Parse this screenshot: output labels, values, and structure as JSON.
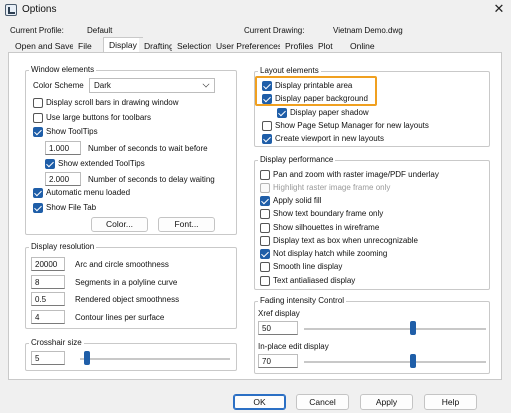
{
  "window": {
    "title": "Options",
    "close_glyph": "✕"
  },
  "header": {
    "current_profile_label": "Current Profile:",
    "current_profile_value": "Default",
    "current_drawing_label": "Current Drawing:",
    "current_drawing_value": "Vietnam Demo.dwg"
  },
  "tabs": [
    {
      "label": "Open and Save"
    },
    {
      "label": "File"
    },
    {
      "label": "Display",
      "active": true
    },
    {
      "label": "Drafting"
    },
    {
      "label": "Selection"
    },
    {
      "label": "User Preferences"
    },
    {
      "label": "Profiles"
    },
    {
      "label": "Plot"
    },
    {
      "label": "Online"
    }
  ],
  "window_elements": {
    "title": "Window elements",
    "color_scheme_label": "Color Scheme",
    "color_scheme_value": "Dark",
    "items": [
      {
        "label": "Display scroll bars in drawing window",
        "checked": false
      },
      {
        "label": "Use large buttons for toolbars",
        "checked": false
      },
      {
        "label": "Show ToolTips",
        "checked": true
      },
      {
        "label": "Show extended ToolTips",
        "checked": true
      },
      {
        "label": "Automatic menu loaded",
        "checked": true
      },
      {
        "label": "Show File Tab",
        "checked": true
      }
    ],
    "tooltip_wait_value": "1.000",
    "tooltip_wait_label": "Number of seconds to wait before",
    "tooltip_delay_value": "2.000",
    "tooltip_delay_label": "Number of seconds to delay waiting",
    "color_button": "Color...",
    "font_button": "Font..."
  },
  "display_resolution": {
    "title": "Display resolution",
    "rows": [
      {
        "value": "20000",
        "label": "Arc and circle smoothness"
      },
      {
        "value": "8",
        "label": "Segments in a polyline curve"
      },
      {
        "value": "0.5",
        "label": "Rendered object smoothness"
      },
      {
        "value": "4",
        "label": "Contour lines per surface"
      }
    ]
  },
  "crosshair": {
    "title": "Crosshair size",
    "value": "5",
    "level": 5
  },
  "layout_elements": {
    "title": "Layout elements",
    "items": [
      {
        "label": "Display printable area",
        "checked": true
      },
      {
        "label": "Display paper background",
        "checked": true
      },
      {
        "label": "Display paper shadow",
        "checked": true
      },
      {
        "label": "Show Page Setup Manager for new layouts",
        "checked": false
      },
      {
        "label": "Create viewport in new layouts",
        "checked": true
      }
    ]
  },
  "display_performance": {
    "title": "Display performance",
    "items": [
      {
        "label": "Pan and zoom with raster image/PDF underlay",
        "checked": false
      },
      {
        "label": "Highlight raster image frame only",
        "checked": false,
        "disabled": true
      },
      {
        "label": "Apply solid fill",
        "checked": true
      },
      {
        "label": "Show text boundary frame only",
        "checked": false
      },
      {
        "label": "Show silhouettes in wireframe",
        "checked": false
      },
      {
        "label": "Display text as box when unrecognizable",
        "checked": false
      },
      {
        "label": "Not display hatch while zooming",
        "checked": true
      },
      {
        "label": "Smooth line display",
        "checked": false
      },
      {
        "label": "Text antialiased display",
        "checked": false
      }
    ]
  },
  "fading": {
    "title": "Fading intensity Control",
    "xref_label": "Xref display",
    "xref_value": "50",
    "inplace_label": "In-place edit display",
    "inplace_value": "70"
  },
  "footer": {
    "ok": "OK",
    "cancel": "Cancel",
    "apply": "Apply",
    "help": "Help"
  },
  "colors": {
    "accent": "#1f5ea8",
    "highlight": "#f0a020"
  }
}
